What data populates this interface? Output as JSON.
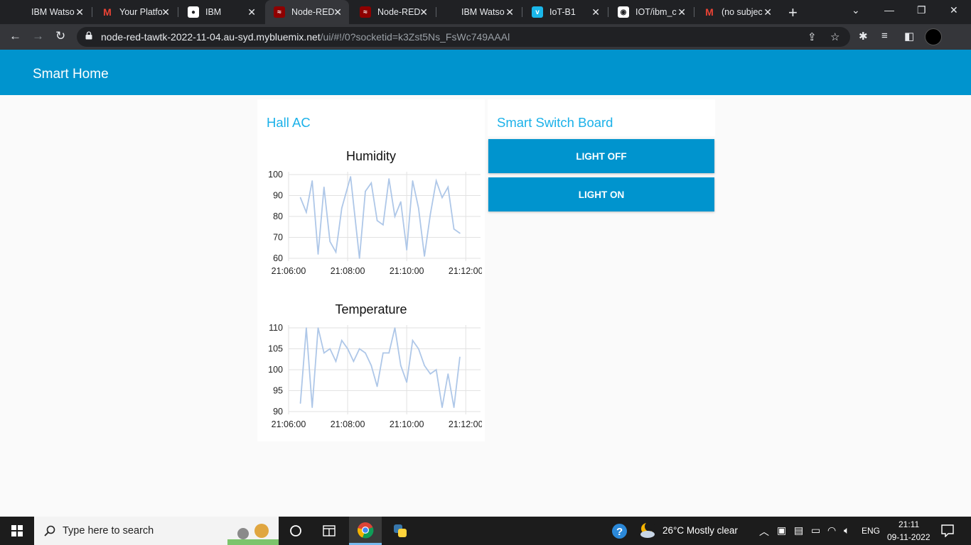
{
  "browser": {
    "tabs": [
      {
        "title": "IBM Watso",
        "icon": "ibm-icon",
        "active": false
      },
      {
        "title": "Your Platfo",
        "icon": "gmail-icon",
        "active": false
      },
      {
        "title": "IBM",
        "icon": "globe-icon",
        "active": false
      },
      {
        "title": "Node-RED",
        "icon": "node-red-icon",
        "active": true
      },
      {
        "title": "Node-RED",
        "icon": "node-red-icon",
        "active": false
      },
      {
        "title": "IBM Watso",
        "icon": "ibm-icon",
        "active": false
      },
      {
        "title": "IoT-B1",
        "icon": "vimeo-icon",
        "active": false
      },
      {
        "title": "IOT/ibm_c",
        "icon": "github-icon",
        "active": false
      },
      {
        "title": "(no subjec",
        "icon": "gmail-icon",
        "active": false
      }
    ],
    "url_host": "node-red-tawtk-2022-11-04.au-syd.mybluemix.net",
    "url_rest": "/ui/#!/0?socketid=k3Zst5Ns_FsWc749AAAl"
  },
  "dashboard": {
    "title": "Smart Home",
    "hall_group": {
      "title": "Hall AC"
    },
    "switch_group": {
      "title": "Smart Switch Board"
    },
    "buttons": {
      "light_off": "LIGHT OFF",
      "light_on": "LIGHT ON"
    }
  },
  "chart_data": [
    {
      "type": "line",
      "title": "Humidity",
      "xlabel": "",
      "ylabel": "",
      "ylim": [
        60,
        100
      ],
      "yticks": [
        60,
        70,
        80,
        90,
        100
      ],
      "xlim_minutes": [
        0,
        6.5
      ],
      "xticks": [
        "21:06:00",
        "21:08:00",
        "21:10:00",
        "21:12:00"
      ],
      "grid": true,
      "color": "#aec7e8",
      "x": [
        0.4,
        0.6,
        0.8,
        1.0,
        1.2,
        1.4,
        1.6,
        1.8,
        2.1,
        2.4,
        2.6,
        2.8,
        3.0,
        3.2,
        3.4,
        3.6,
        3.8,
        4.0,
        4.2,
        4.4,
        4.6,
        4.8,
        5.0,
        5.2,
        5.4,
        5.6,
        5.8
      ],
      "y": [
        89,
        82,
        97,
        62,
        94,
        68,
        63,
        84,
        99,
        60,
        92,
        96,
        78,
        76,
        98,
        80,
        87,
        64,
        97,
        84,
        61,
        81,
        97,
        89,
        94,
        74,
        72
      ]
    },
    {
      "type": "line",
      "title": "Temperature",
      "xlabel": "",
      "ylabel": "",
      "ylim": [
        90,
        110
      ],
      "yticks": [
        90,
        95,
        100,
        105,
        110
      ],
      "xlim_minutes": [
        0,
        6.5
      ],
      "xticks": [
        "21:06:00",
        "21:08:00",
        "21:10:00",
        "21:12:00"
      ],
      "grid": true,
      "color": "#aec7e8",
      "x": [
        0.4,
        0.6,
        0.8,
        1.0,
        1.2,
        1.4,
        1.6,
        1.8,
        2.0,
        2.2,
        2.4,
        2.6,
        2.8,
        3.0,
        3.2,
        3.4,
        3.6,
        3.8,
        4.0,
        4.2,
        4.4,
        4.6,
        4.8,
        5.0,
        5.2,
        5.4,
        5.6,
        5.8
      ],
      "y": [
        92,
        110,
        91,
        110,
        104,
        105,
        102,
        107,
        105,
        102,
        105,
        104,
        101,
        96,
        104,
        104,
        110,
        101,
        97,
        107,
        105,
        101,
        99,
        100,
        91,
        99,
        91,
        103
      ]
    }
  ],
  "taskbar": {
    "search_placeholder": "Type here to search",
    "weather": "26°C  Mostly clear",
    "language": "ENG",
    "time": "21:11",
    "date": "09-11-2022"
  }
}
